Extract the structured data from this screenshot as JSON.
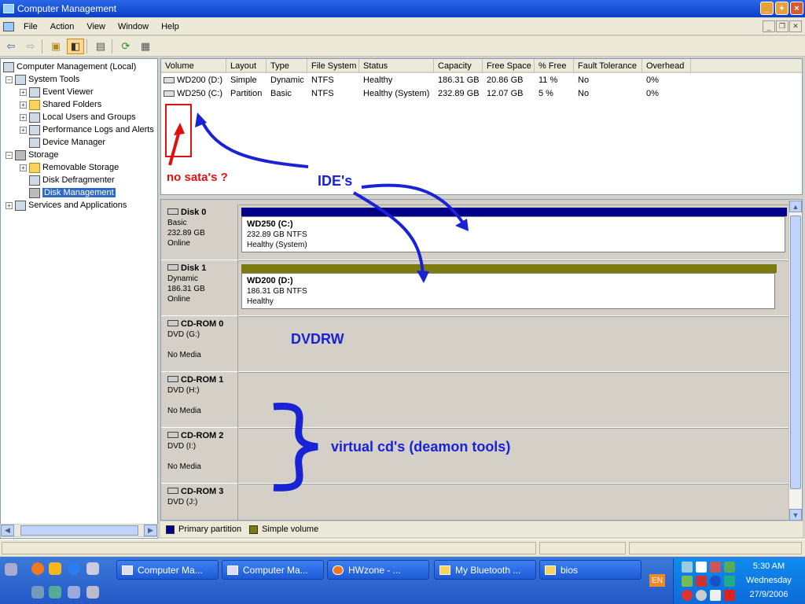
{
  "window": {
    "title": "Computer Management",
    "buttons": {
      "minimize": "_",
      "maximize": "+",
      "close": "×"
    }
  },
  "menu": [
    "File",
    "Action",
    "View",
    "Window",
    "Help"
  ],
  "tree": {
    "root": "Computer Management (Local)",
    "system_tools": "System Tools",
    "event_viewer": "Event Viewer",
    "shared_folders": "Shared Folders",
    "local_users": "Local Users and Groups",
    "perf_logs": "Performance Logs and Alerts",
    "device_manager": "Device Manager",
    "storage": "Storage",
    "removable_storage": "Removable Storage",
    "disk_defrag": "Disk Defragmenter",
    "disk_management": "Disk Management",
    "services": "Services and Applications"
  },
  "volumes": {
    "columns": [
      "Volume",
      "Layout",
      "Type",
      "File System",
      "Status",
      "Capacity",
      "Free Space",
      "% Free",
      "Fault Tolerance",
      "Overhead"
    ],
    "rows": [
      [
        "WD200 (D:)",
        "Simple",
        "Dynamic",
        "NTFS",
        "Healthy",
        "186.31 GB",
        "20.86 GB",
        "11 %",
        "No",
        "0%"
      ],
      [
        "WD250 (C:)",
        "Partition",
        "Basic",
        "NTFS",
        "Healthy (System)",
        "232.89 GB",
        "12.07 GB",
        "5 %",
        "No",
        "0%"
      ]
    ]
  },
  "disks": [
    {
      "name": "Disk 0",
      "type": "Basic",
      "size": "232.89 GB",
      "state": "Online",
      "part_name": "WD250  (C:)",
      "part_size": "232.89 GB NTFS",
      "part_status": "Healthy (System)"
    },
    {
      "name": "Disk 1",
      "type": "Dynamic",
      "size": "186.31 GB",
      "state": "Online",
      "part_name": "WD200  (D:)",
      "part_size": "186.31 GB NTFS",
      "part_status": "Healthy"
    }
  ],
  "cdroms": [
    {
      "name": "CD-ROM 0",
      "drive": "DVD (G:)",
      "media": "No Media"
    },
    {
      "name": "CD-ROM 1",
      "drive": "DVD (H:)",
      "media": "No Media"
    },
    {
      "name": "CD-ROM 2",
      "drive": "DVD (I:)",
      "media": "No Media"
    },
    {
      "name": "CD-ROM 3",
      "drive": "DVD (J:)",
      "media": ""
    }
  ],
  "legend": {
    "primary": "Primary partition",
    "simple": "Simple volume"
  },
  "colors": {
    "primary": "#00008b",
    "simple": "#7b7b0f",
    "annotation_blue": "#1a22d6",
    "annotation_red": "#e01010"
  },
  "annotations": {
    "no_sata": "no sata's ?",
    "ides": "IDE's",
    "dvdrw": "DVDRW",
    "virtual": "virtual cd's (deamon tools)"
  },
  "taskbar": {
    "items": [
      "Computer Ma...",
      "Computer Ma...",
      "HWzone - ...",
      "My Bluetooth ...",
      "bios"
    ],
    "lang": "EN",
    "time": "5:30 AM",
    "day": "Wednesday",
    "date": "27/9/2006"
  }
}
